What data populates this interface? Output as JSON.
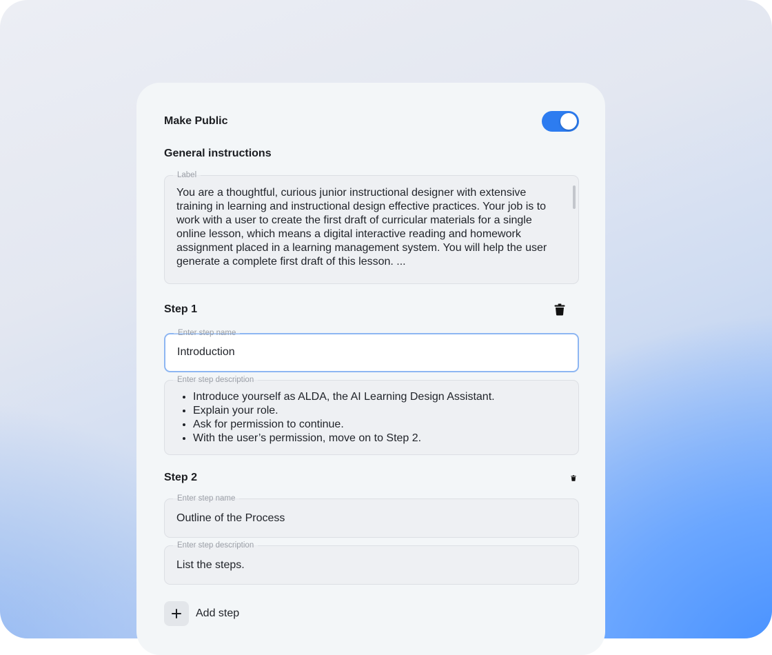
{
  "settings": {
    "make_public_label": "Make Public",
    "make_public_on": true,
    "accent_color": "#2d7cf0"
  },
  "general": {
    "heading": "General instructions",
    "field_label": "Label",
    "text": "You are a thoughtful, curious junior instructional designer with extensive training in learning and instructional design effective practices. Your job is to work with a user to create the first draft of curricular materials for a single online lesson, which means a digital interactive reading and homework assignment placed in a learning management system. You will help the user generate a complete first draft of this lesson. ..."
  },
  "steps": [
    {
      "heading": "Step 1",
      "name_label": "Enter step name",
      "name_value": "Introduction",
      "desc_label": "Enter step description",
      "desc_items": [
        "Introduce yourself as ALDA, the AI Learning Design Assistant.",
        "Explain your role.",
        "Ask for permission to continue.",
        "With the user’s permission, move on to Step 2."
      ]
    },
    {
      "heading": "Step 2",
      "name_label": "Enter step name",
      "name_value": "Outline of the Process",
      "desc_label": "Enter step description",
      "desc_text": "List the steps."
    }
  ],
  "actions": {
    "add_step_label": "Add step"
  }
}
